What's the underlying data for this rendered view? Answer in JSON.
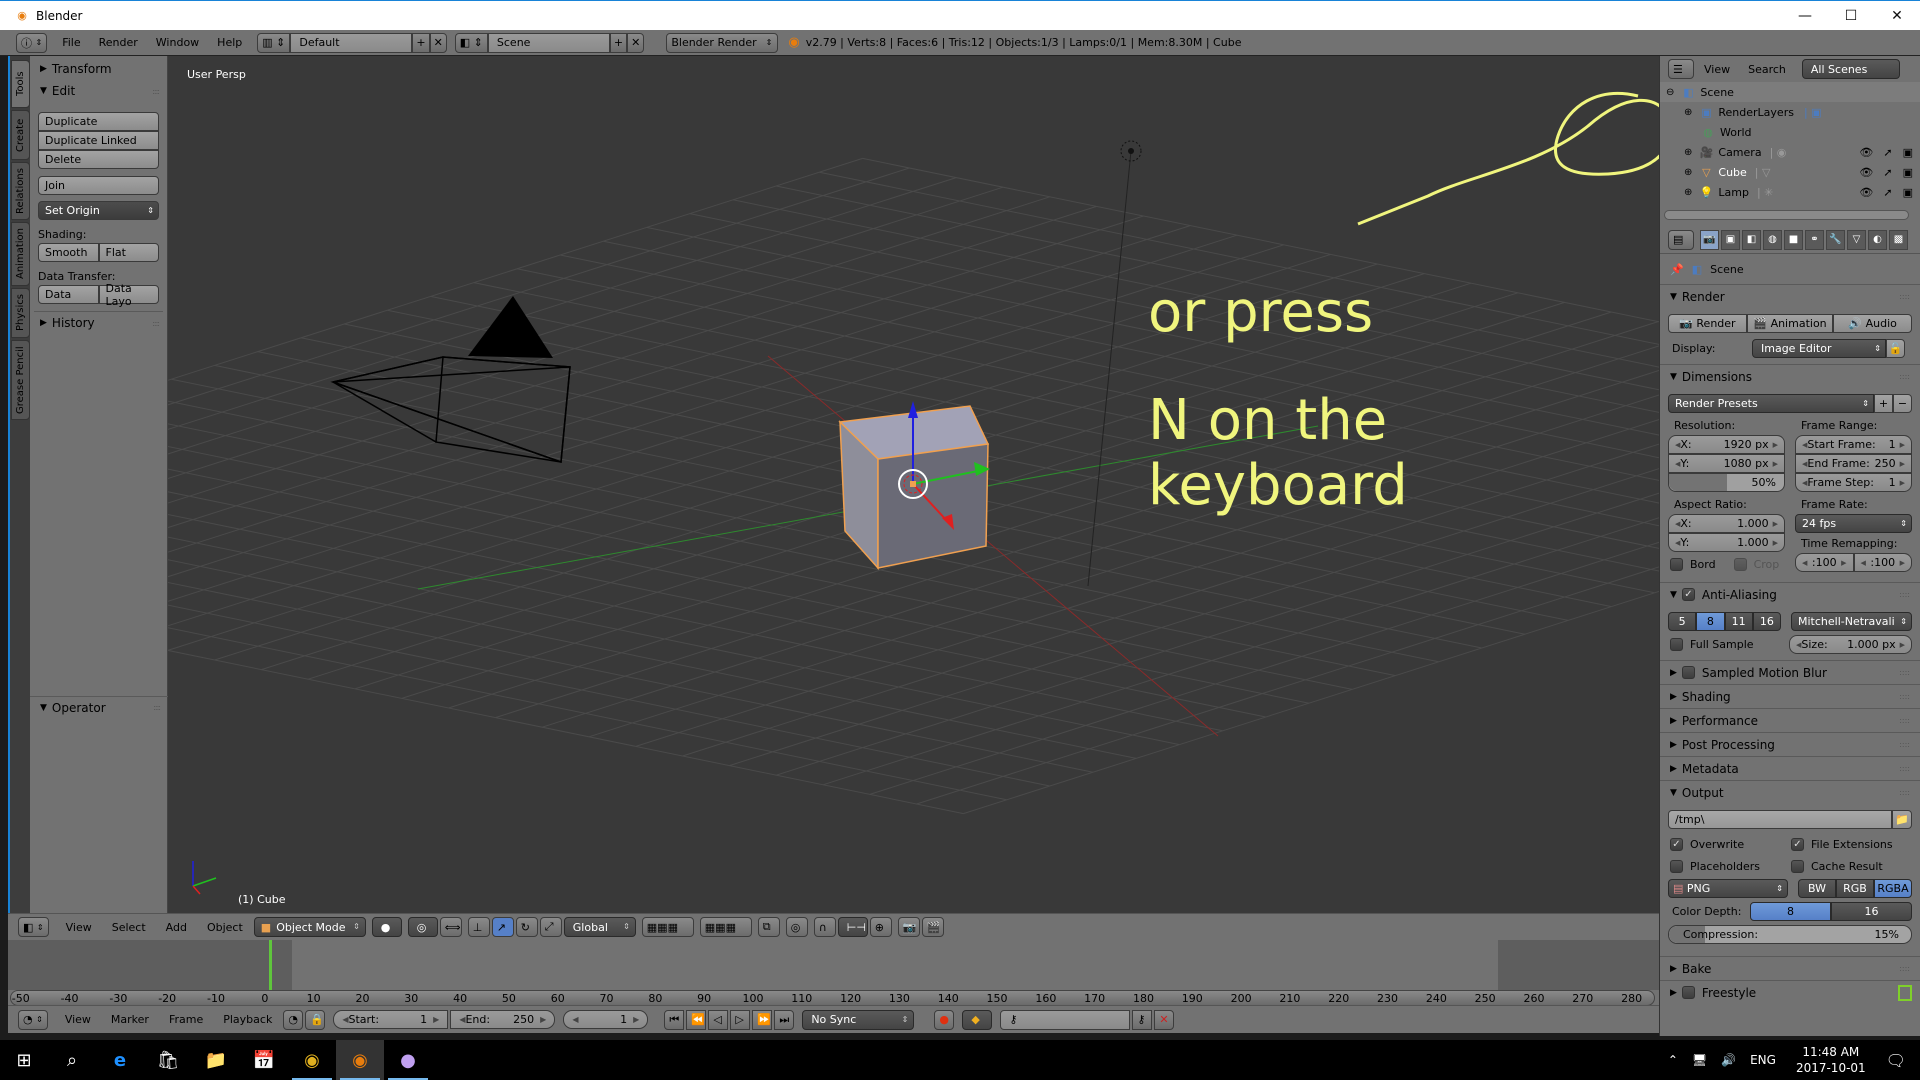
{
  "window": {
    "title": "Blender",
    "controls": [
      "minimize",
      "maximize",
      "close"
    ]
  },
  "info_header": {
    "menus": [
      "File",
      "Render",
      "Window",
      "Help"
    ],
    "screen_layout": "Default",
    "scene": "Scene",
    "render_engine": "Blender Render",
    "stats": "v2.79 | Verts:8 | Faces:6 | Tris:12 | Objects:1/3 | Lamps:0/1 | Mem:8.30M | Cube"
  },
  "tool_tabs": [
    "Tools",
    "Create",
    "Relations",
    "Animation",
    "Physics",
    "Grease Pencil"
  ],
  "tool_shelf": {
    "transform": "Transform",
    "edit": "Edit",
    "duplicate": "Duplicate",
    "duplicate_linked": "Duplicate Linked",
    "delete": "Delete",
    "join": "Join",
    "set_origin": "Set Origin",
    "shading_label": "Shading:",
    "smooth": "Smooth",
    "flat": "Flat",
    "data_transfer_label": "Data Transfer:",
    "data": "Data",
    "data_layout": "Data Layo",
    "history": "History",
    "operator": "Operator"
  },
  "viewport": {
    "view_name": "User Persp",
    "active_object": "(1) Cube",
    "annotation_line1": "or press",
    "annotation_line2": "N on the keyboard",
    "annotation_color": "#f0f57e"
  },
  "view3d_header": {
    "menus": [
      "View",
      "Select",
      "Add",
      "Object"
    ],
    "mode": "Object Mode",
    "orientation": "Global"
  },
  "timeline": {
    "ticks": [
      -50,
      -40,
      -30,
      -20,
      -10,
      0,
      10,
      20,
      30,
      40,
      50,
      60,
      70,
      80,
      90,
      100,
      110,
      120,
      130,
      140,
      150,
      160,
      170,
      180,
      190,
      200,
      210,
      220,
      230,
      240,
      250,
      260,
      270,
      280
    ],
    "current_frame_marker": 1,
    "menus": [
      "View",
      "Marker",
      "Frame",
      "Playback"
    ],
    "start_label": "Start:",
    "start": "1",
    "end_label": "End:",
    "end": "250",
    "current": "1",
    "sync": "No Sync"
  },
  "outliner": {
    "view": "View",
    "search": "Search",
    "filter": "All Scenes",
    "items": [
      {
        "name": "Scene",
        "icon": "scene-icon"
      },
      {
        "name": "RenderLayers",
        "icon": "render-layers-icon"
      },
      {
        "name": "World",
        "icon": "world-icon"
      },
      {
        "name": "Camera",
        "icon": "camera-icon"
      },
      {
        "name": "Cube",
        "icon": "mesh-icon"
      },
      {
        "name": "Lamp",
        "icon": "lamp-icon"
      }
    ]
  },
  "properties": {
    "context": "Scene",
    "render": {
      "title": "Render",
      "render_btn": "Render",
      "animation_btn": "Animation",
      "audio_btn": "Audio",
      "display_label": "Display:",
      "display": "Image Editor"
    },
    "dimensions": {
      "title": "Dimensions",
      "presets": "Render Presets",
      "resolution_label": "Resolution:",
      "res_x_label": "X:",
      "res_x": "1920 px",
      "res_y_label": "Y:",
      "res_y": "1080 px",
      "res_pct": "50%",
      "res_pct_value": 0.5,
      "frame_range_label": "Frame Range:",
      "start_frame_label": "Start Frame:",
      "start_frame": "1",
      "end_frame_label": "End Frame:",
      "end_frame": "250",
      "frame_step_label": "Frame Step:",
      "frame_step": "1",
      "aspect_label": "Aspect Ratio:",
      "asp_x": "1.000",
      "asp_y": "1.000",
      "frame_rate_label": "Frame Rate:",
      "frame_rate": "24 fps",
      "time_remap_label": "Time Remapping:",
      "remap_old": ":100",
      "remap_new": ":100",
      "bord": "Bord",
      "crop": "Crop"
    },
    "anti_aliasing": {
      "title": "Anti-Aliasing",
      "samples": [
        "5",
        "8",
        "11",
        "16"
      ],
      "selected": "8",
      "filter": "Mitchell-Netravali",
      "full_sample": "Full Sample",
      "size_label": "Size:",
      "size": "1.000 px"
    },
    "collapsed": [
      "Sampled Motion Blur",
      "Shading",
      "Performance",
      "Post Processing",
      "Metadata"
    ],
    "output": {
      "title": "Output",
      "path": "/tmp\\",
      "overwrite": "Overwrite",
      "file_extensions": "File Extensions",
      "placeholders": "Placeholders",
      "cache_result": "Cache Result",
      "format": "PNG",
      "color_modes": [
        "BW",
        "RGB",
        "RGBA"
      ],
      "color_mode_selected": "RGBA",
      "color_depth_label": "Color Depth:",
      "depths": [
        "8",
        "16"
      ],
      "depth_selected": "8",
      "compression_label": "Compression:",
      "compression": "15%",
      "compression_value": 0.15
    },
    "bake": "Bake",
    "freestyle": "Freestyle"
  },
  "taskbar": {
    "apps": [
      "start",
      "search",
      "edge",
      "store",
      "file-explorer",
      "calendar",
      "chrome",
      "blender",
      "paint"
    ],
    "language": "ENG",
    "time": "11:48 AM",
    "date": "2017-10-01"
  }
}
